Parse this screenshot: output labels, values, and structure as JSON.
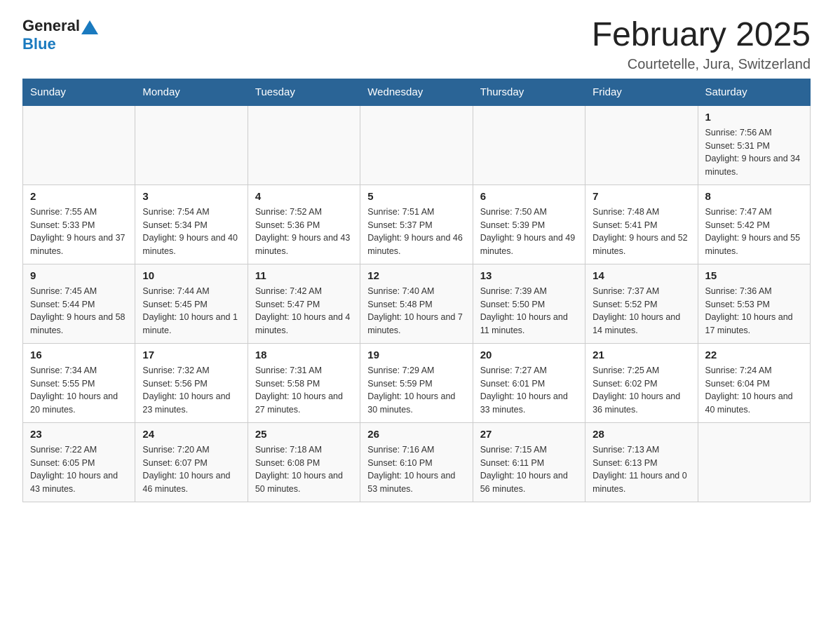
{
  "header": {
    "logo_general": "General",
    "logo_blue": "Blue",
    "month_title": "February 2025",
    "location": "Courtetelle, Jura, Switzerland"
  },
  "weekdays": [
    "Sunday",
    "Monday",
    "Tuesday",
    "Wednesday",
    "Thursday",
    "Friday",
    "Saturday"
  ],
  "weeks": [
    [
      {
        "day": "",
        "info": ""
      },
      {
        "day": "",
        "info": ""
      },
      {
        "day": "",
        "info": ""
      },
      {
        "day": "",
        "info": ""
      },
      {
        "day": "",
        "info": ""
      },
      {
        "day": "",
        "info": ""
      },
      {
        "day": "1",
        "info": "Sunrise: 7:56 AM\nSunset: 5:31 PM\nDaylight: 9 hours and 34 minutes."
      }
    ],
    [
      {
        "day": "2",
        "info": "Sunrise: 7:55 AM\nSunset: 5:33 PM\nDaylight: 9 hours and 37 minutes."
      },
      {
        "day": "3",
        "info": "Sunrise: 7:54 AM\nSunset: 5:34 PM\nDaylight: 9 hours and 40 minutes."
      },
      {
        "day": "4",
        "info": "Sunrise: 7:52 AM\nSunset: 5:36 PM\nDaylight: 9 hours and 43 minutes."
      },
      {
        "day": "5",
        "info": "Sunrise: 7:51 AM\nSunset: 5:37 PM\nDaylight: 9 hours and 46 minutes."
      },
      {
        "day": "6",
        "info": "Sunrise: 7:50 AM\nSunset: 5:39 PM\nDaylight: 9 hours and 49 minutes."
      },
      {
        "day": "7",
        "info": "Sunrise: 7:48 AM\nSunset: 5:41 PM\nDaylight: 9 hours and 52 minutes."
      },
      {
        "day": "8",
        "info": "Sunrise: 7:47 AM\nSunset: 5:42 PM\nDaylight: 9 hours and 55 minutes."
      }
    ],
    [
      {
        "day": "9",
        "info": "Sunrise: 7:45 AM\nSunset: 5:44 PM\nDaylight: 9 hours and 58 minutes."
      },
      {
        "day": "10",
        "info": "Sunrise: 7:44 AM\nSunset: 5:45 PM\nDaylight: 10 hours and 1 minute."
      },
      {
        "day": "11",
        "info": "Sunrise: 7:42 AM\nSunset: 5:47 PM\nDaylight: 10 hours and 4 minutes."
      },
      {
        "day": "12",
        "info": "Sunrise: 7:40 AM\nSunset: 5:48 PM\nDaylight: 10 hours and 7 minutes."
      },
      {
        "day": "13",
        "info": "Sunrise: 7:39 AM\nSunset: 5:50 PM\nDaylight: 10 hours and 11 minutes."
      },
      {
        "day": "14",
        "info": "Sunrise: 7:37 AM\nSunset: 5:52 PM\nDaylight: 10 hours and 14 minutes."
      },
      {
        "day": "15",
        "info": "Sunrise: 7:36 AM\nSunset: 5:53 PM\nDaylight: 10 hours and 17 minutes."
      }
    ],
    [
      {
        "day": "16",
        "info": "Sunrise: 7:34 AM\nSunset: 5:55 PM\nDaylight: 10 hours and 20 minutes."
      },
      {
        "day": "17",
        "info": "Sunrise: 7:32 AM\nSunset: 5:56 PM\nDaylight: 10 hours and 23 minutes."
      },
      {
        "day": "18",
        "info": "Sunrise: 7:31 AM\nSunset: 5:58 PM\nDaylight: 10 hours and 27 minutes."
      },
      {
        "day": "19",
        "info": "Sunrise: 7:29 AM\nSunset: 5:59 PM\nDaylight: 10 hours and 30 minutes."
      },
      {
        "day": "20",
        "info": "Sunrise: 7:27 AM\nSunset: 6:01 PM\nDaylight: 10 hours and 33 minutes."
      },
      {
        "day": "21",
        "info": "Sunrise: 7:25 AM\nSunset: 6:02 PM\nDaylight: 10 hours and 36 minutes."
      },
      {
        "day": "22",
        "info": "Sunrise: 7:24 AM\nSunset: 6:04 PM\nDaylight: 10 hours and 40 minutes."
      }
    ],
    [
      {
        "day": "23",
        "info": "Sunrise: 7:22 AM\nSunset: 6:05 PM\nDaylight: 10 hours and 43 minutes."
      },
      {
        "day": "24",
        "info": "Sunrise: 7:20 AM\nSunset: 6:07 PM\nDaylight: 10 hours and 46 minutes."
      },
      {
        "day": "25",
        "info": "Sunrise: 7:18 AM\nSunset: 6:08 PM\nDaylight: 10 hours and 50 minutes."
      },
      {
        "day": "26",
        "info": "Sunrise: 7:16 AM\nSunset: 6:10 PM\nDaylight: 10 hours and 53 minutes."
      },
      {
        "day": "27",
        "info": "Sunrise: 7:15 AM\nSunset: 6:11 PM\nDaylight: 10 hours and 56 minutes."
      },
      {
        "day": "28",
        "info": "Sunrise: 7:13 AM\nSunset: 6:13 PM\nDaylight: 11 hours and 0 minutes."
      },
      {
        "day": "",
        "info": ""
      }
    ]
  ]
}
